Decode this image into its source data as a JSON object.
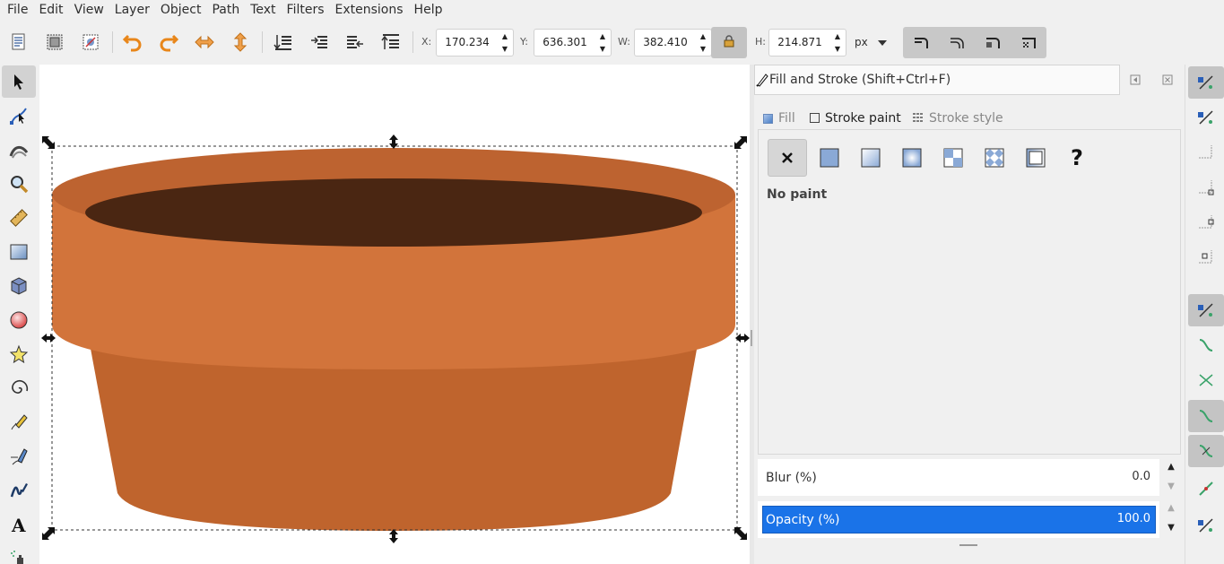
{
  "menu": [
    "File",
    "Edit",
    "View",
    "Layer",
    "Object",
    "Path",
    "Text",
    "Filters",
    "Extensions",
    "Help"
  ],
  "toolbar": {
    "x_label": "X:",
    "x_value": "170.234",
    "y_label": "Y:",
    "y_value": "636.301",
    "w_label": "W:",
    "w_value": "382.410",
    "h_label": "H:",
    "h_value": "214.871",
    "unit": "px",
    "icons": [
      "select-all-icon",
      "select-all-layers-icon",
      "deselect-icon",
      "rotate-ccw-icon",
      "rotate-cw-icon",
      "flip-horizontal-icon",
      "flip-vertical-icon",
      "lower-to-bottom-icon",
      "lower-icon",
      "raise-icon",
      "raise-to-top-icon",
      "lock-icon"
    ]
  },
  "tools": [
    "selector-tool",
    "node-tool",
    "tweak-tool",
    "zoom-tool",
    "measure-tool",
    "rectangle-tool",
    "3d-box-tool",
    "ellipse-tool",
    "star-tool",
    "spiral-tool",
    "pencil-tool",
    "pen-tool",
    "calligraphy-tool",
    "text-tool",
    "spray-tool"
  ],
  "canvas": {
    "colors": {
      "rim": "#d2743b",
      "rim_top": "#bd6330",
      "body": "#bf642d",
      "interior": "#4a2612"
    }
  },
  "dialog": {
    "title": "Fill and Stroke (Shift+Ctrl+F)",
    "tabs": {
      "fill": "Fill",
      "stroke_paint": "Stroke paint",
      "stroke_style": "Stroke style"
    },
    "paint_types": [
      "no-paint-icon",
      "flat-color-icon",
      "linear-gradient-icon",
      "radial-gradient-icon",
      "pattern-icon",
      "swatch-icon",
      "mesh-gradient-icon",
      "unset-paint-icon"
    ],
    "unset_glyph": "?",
    "status": "No paint",
    "blur_label": "Blur (%)",
    "blur_value": "0.0",
    "opacity_label": "Opacity (%)",
    "opacity_value": "100.0",
    "accent": "#1a73e8"
  },
  "snap_controls": [
    "snap-enable-icon",
    "snap-bbox-icon",
    "snap-bbox-edges-icon",
    "snap-bbox-corners-icon",
    "snap-bbox-midpoints-icon",
    "snap-bbox-centers-icon",
    "snap-nodes-icon",
    "snap-paths-icon",
    "snap-intersections-icon",
    "snap-cusp-nodes-icon",
    "snap-smooth-nodes-icon",
    "snap-line-midpoints-icon",
    "snap-others-icon"
  ]
}
